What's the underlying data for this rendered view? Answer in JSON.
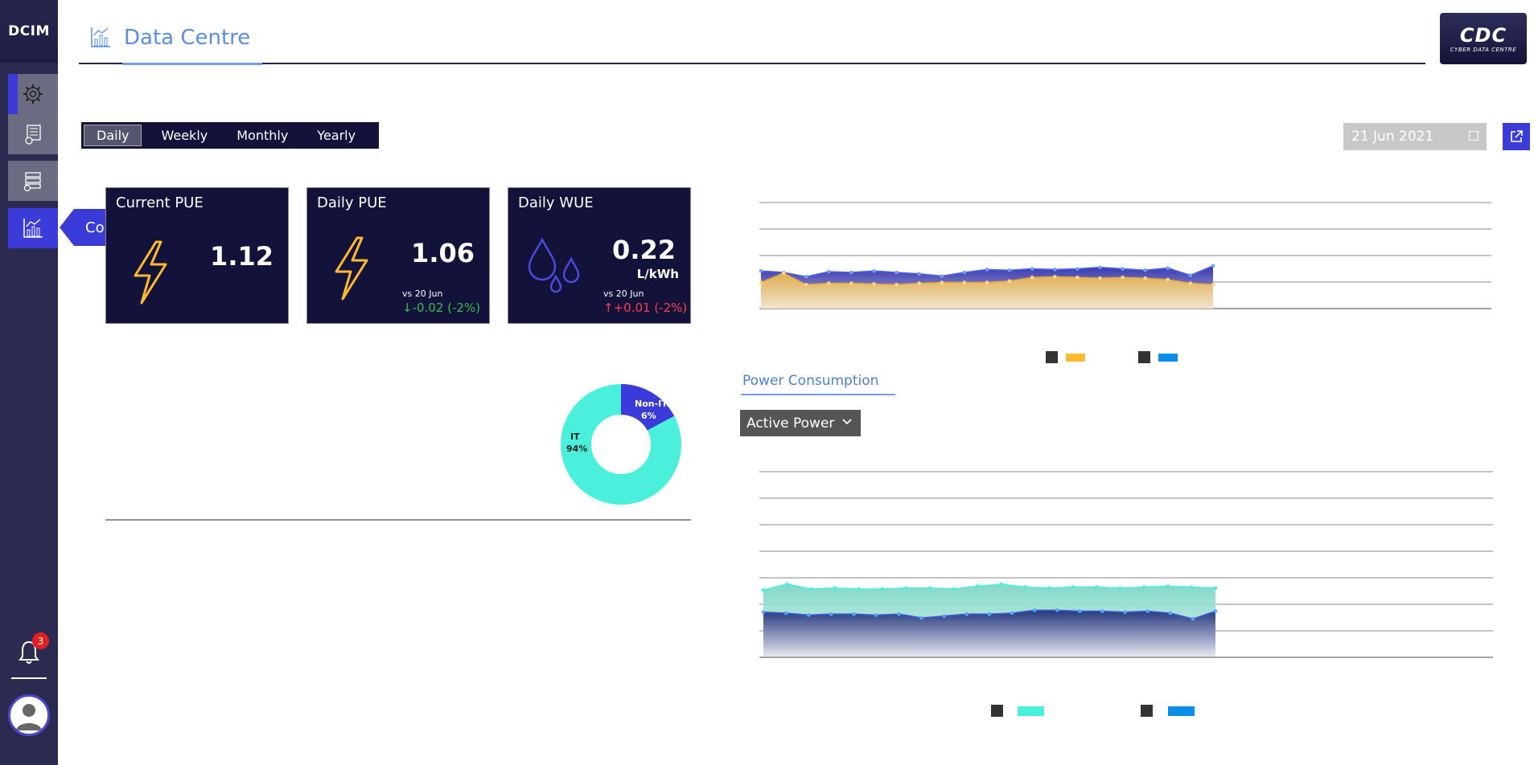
{
  "app": {
    "brand": "DCIM",
    "title": "Data Centre",
    "logo_main": "CDC",
    "logo_sub": "CYBER DATA CENTRE"
  },
  "sidebar": {
    "items": [
      {
        "icon": "settings-gear-icon"
      },
      {
        "icon": "server-settings-icon"
      },
      {
        "icon": "database-settings-icon"
      },
      {
        "icon": "consumption-chart-icon",
        "tooltip": "Consumption"
      }
    ],
    "notifications": "3"
  },
  "period_tabs": [
    "Daily",
    "Weekly",
    "Monthly",
    "Yearly"
  ],
  "selected_date": "21 Jun 2021",
  "kpis": [
    {
      "title": "Current PUE",
      "value": "1.12"
    },
    {
      "title": "Daily PUE",
      "value": "1.06",
      "vs": "vs 20 Jun",
      "delta": "-0.02 (-2%)",
      "direction": "down"
    },
    {
      "title": "Daily WUE",
      "value": "0.22",
      "unit": "L/kWh",
      "vs": "vs 20 Jun",
      "delta": "+0.01 (-2%)",
      "direction": "up"
    }
  ],
  "donut": {
    "slices": [
      {
        "label": "Non-IT",
        "pct": "6%",
        "value": 6,
        "color": "#3b3bd9"
      },
      {
        "label": "IT",
        "pct": "94%",
        "value": 94,
        "color": "#4af0dc"
      }
    ]
  },
  "power_section": {
    "title": "Power Consumption",
    "dropdown": "Active Power"
  },
  "colors": {
    "accent": "#3b3bd9",
    "navy": "#12123a",
    "orange": "#ffb92e",
    "cyan": "#4af0dc",
    "blue": "#0a8ee8"
  },
  "top_chart": {
    "series_a": [
      5.2,
      5.0,
      4.4,
      5.1,
      5.0,
      5.2,
      5.0,
      4.8,
      4.5,
      5.0,
      5.4,
      5.3,
      5.5,
      5.4,
      5.5,
      5.7,
      5.5,
      5.3,
      5.6,
      4.6,
      5.9
    ],
    "series_b": [
      3.6,
      4.9,
      3.3,
      3.5,
      3.5,
      3.4,
      3.3,
      3.5,
      3.6,
      3.6,
      3.6,
      3.8,
      4.3,
      4.4,
      4.3,
      4.2,
      4.3,
      4.2,
      4.0,
      3.5,
      3.3
    ]
  },
  "bottom_chart": {
    "series_a": [
      6.9,
      7.5,
      7.0,
      7.1,
      7.0,
      7.0,
      7.1,
      7.1,
      7.0,
      7.3,
      7.5,
      7.2,
      7.1,
      7.2,
      7.2,
      7.1,
      7.2,
      7.3,
      7.2,
      7.1
    ],
    "series_b": [
      4.6,
      4.5,
      4.3,
      4.4,
      4.4,
      4.3,
      4.4,
      4.0,
      4.2,
      4.4,
      4.4,
      4.5,
      4.8,
      4.8,
      4.7,
      4.7,
      4.6,
      4.7,
      4.5,
      3.9,
      4.7
    ]
  }
}
